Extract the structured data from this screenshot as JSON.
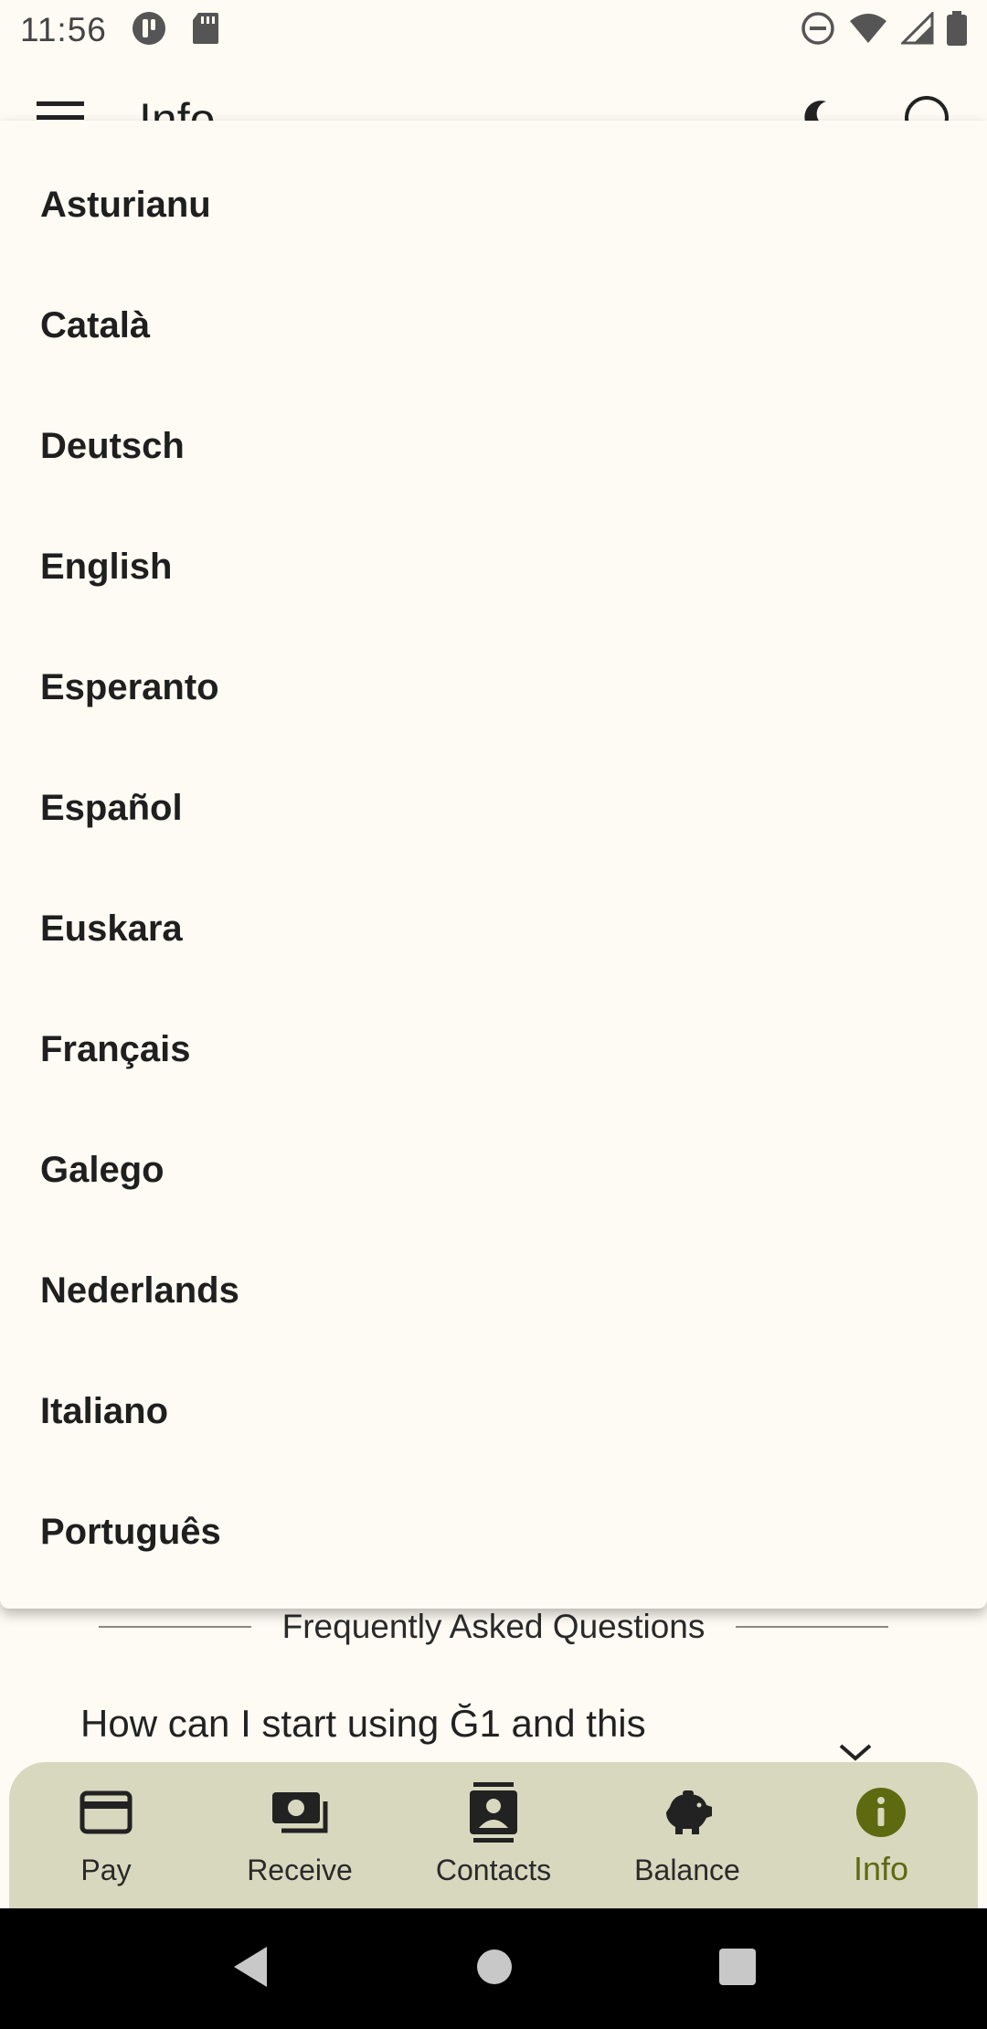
{
  "status_bar": {
    "time": "11:56"
  },
  "app_bar": {
    "title": "Info"
  },
  "language_menu": {
    "items": [
      "Asturianu",
      "Català",
      "Deutsch",
      "English",
      "Esperanto",
      "Español",
      "Euskara",
      "Français",
      "Galego",
      "Nederlands",
      "Italiano",
      "Português"
    ]
  },
  "faq": {
    "title": "Frequently Asked Questions",
    "question": "How can I start using Ğ1 and this"
  },
  "bottom_nav": {
    "items": [
      {
        "label": "Pay",
        "icon": "credit-card-icon"
      },
      {
        "label": "Receive",
        "icon": "cash-icon"
      },
      {
        "label": "Contacts",
        "icon": "contacts-icon"
      },
      {
        "label": "Balance",
        "icon": "piggy-bank-icon"
      },
      {
        "label": "Info",
        "icon": "info-icon"
      }
    ],
    "active": "Info"
  },
  "colors": {
    "background": "#fdfbf3",
    "nav_background": "#d8d8bf",
    "accent": "#5d6a10"
  }
}
